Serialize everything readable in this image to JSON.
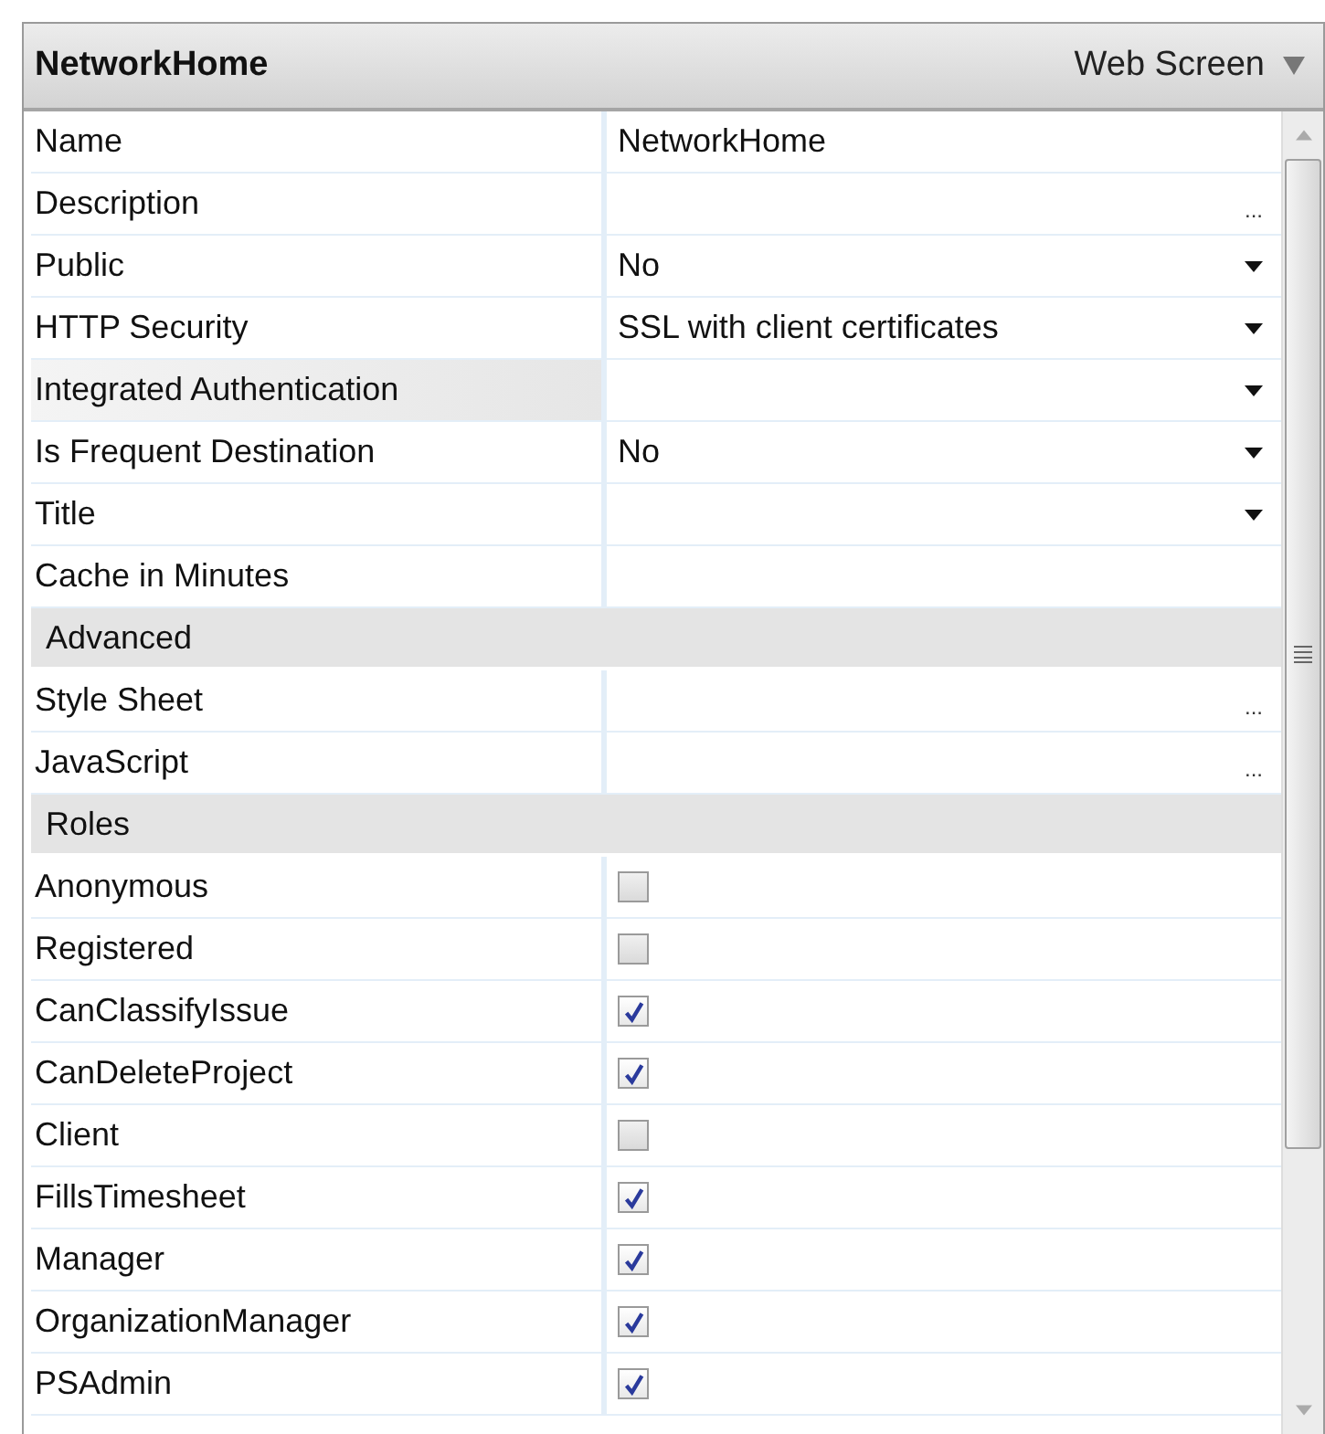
{
  "header": {
    "title": "NetworkHome",
    "type": "Web Screen"
  },
  "rows": [
    {
      "kind": "text",
      "label": "Name",
      "value": "NetworkHome",
      "selected": false
    },
    {
      "kind": "ellipsis",
      "label": "Description",
      "button": "...",
      "selected": false
    },
    {
      "kind": "dropdown",
      "label": "Public",
      "value": "No",
      "selected": false
    },
    {
      "kind": "dropdown",
      "label": "HTTP Security",
      "value": "SSL with client certificates",
      "selected": false
    },
    {
      "kind": "dropdown",
      "label": "Integrated Authentication",
      "selected": true
    },
    {
      "kind": "dropdown",
      "label": "Is Frequent Destination",
      "value": "No",
      "selected": false
    },
    {
      "kind": "dropdown",
      "label": "Title",
      "selected": false
    },
    {
      "kind": "text",
      "label": "Cache in Minutes",
      "selected": false
    },
    {
      "kind": "category",
      "label": "Advanced"
    },
    {
      "kind": "ellipsis",
      "label": "Style Sheet",
      "button": "...",
      "selected": false
    },
    {
      "kind": "ellipsis",
      "label": "JavaScript",
      "button": "...",
      "selected": false
    },
    {
      "kind": "category",
      "label": "Roles"
    },
    {
      "kind": "checkbox",
      "label": "Anonymous",
      "checked": false,
      "selected": false
    },
    {
      "kind": "checkbox",
      "label": "Registered",
      "checked": false,
      "selected": false
    },
    {
      "kind": "checkbox",
      "label": "CanClassifyIssue",
      "checked": true,
      "selected": false
    },
    {
      "kind": "checkbox",
      "label": "CanDeleteProject",
      "checked": true,
      "selected": false
    },
    {
      "kind": "checkbox",
      "label": "Client",
      "checked": false,
      "selected": false
    },
    {
      "kind": "checkbox",
      "label": "FillsTimesheet",
      "checked": true,
      "selected": false
    },
    {
      "kind": "checkbox",
      "label": "Manager",
      "checked": true,
      "selected": false
    },
    {
      "kind": "checkbox",
      "label": "OrganizationManager",
      "checked": true,
      "selected": false
    },
    {
      "kind": "checkbox",
      "label": "PSAdmin",
      "checked": true,
      "selected": false
    }
  ]
}
